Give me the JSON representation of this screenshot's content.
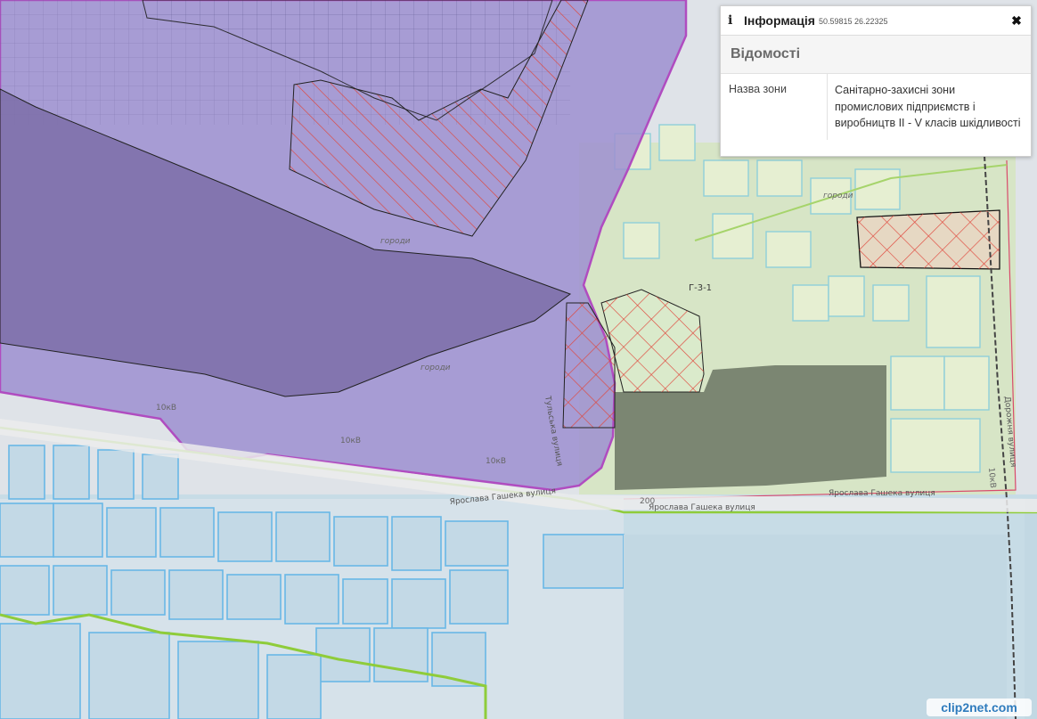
{
  "info_panel": {
    "title": "Інформація",
    "coordinates": "50.59815 26.22325",
    "section": "Відомості",
    "rows": [
      {
        "label": "Назва зони",
        "value": "Санітарно-захисні зони промислових підприємств і виробництв II - V класів шкідливості"
      }
    ]
  },
  "map_labels": {
    "street_1": "Ярослава Гашека вулиця",
    "street_2": "Ярослава Гашека вулиця",
    "street_3": "Ярослава Гашека вулиця",
    "street_4": "Тульська вулиця",
    "street_5": "Дорожня вулиця",
    "power_1": "10кВ",
    "power_2": "10кВ",
    "power_3": "10кВ",
    "power_4": "10кВ",
    "gardens_1": "городи",
    "gardens_2": "городи",
    "gardens_3": "городи",
    "zone_code": "Г-3-1",
    "number_200": "200"
  },
  "watermark": "clip2net.com"
}
